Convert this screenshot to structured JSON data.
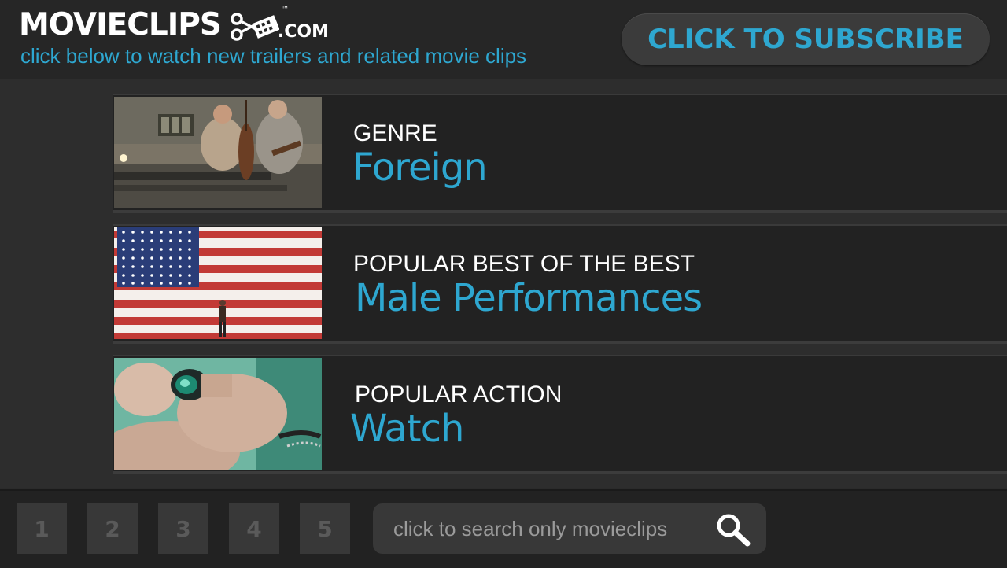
{
  "header": {
    "logo_text": "MOVIECLIPS",
    "logo_tm": "™",
    "logo_domain": ".COM",
    "tagline": "click below to watch new trailers and related movie clips",
    "subscribe_label": "CLICK TO SUBSCRIBE"
  },
  "rows": [
    {
      "category": "GENRE",
      "title": "Foreign",
      "thumbnail": "band-rehearsal-scene"
    },
    {
      "category": "POPULAR BEST OF THE BEST",
      "title": "Male Performances",
      "thumbnail": "american-flag-scene"
    },
    {
      "category": "POPULAR ACTION",
      "title": "Watch",
      "thumbnail": "binoculars-scene"
    }
  ],
  "footer": {
    "pages": [
      "1",
      "2",
      "3",
      "4",
      "5"
    ],
    "search_placeholder": "click to search only movieclips",
    "search_icon": "search-icon"
  },
  "colors": {
    "accent": "#2ea7d0",
    "background": "#2b2b2b",
    "header_bg": "#262626",
    "button_bg": "#3b3b3b"
  }
}
